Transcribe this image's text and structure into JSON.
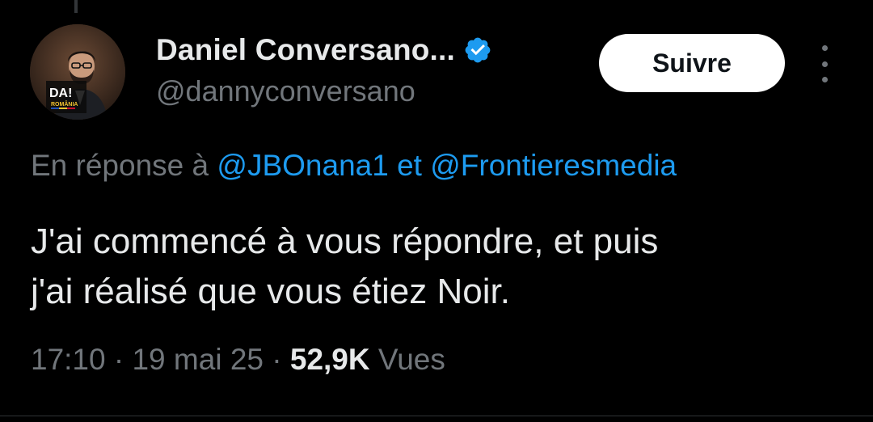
{
  "author": {
    "display_name": "Daniel Conversano...",
    "handle": "@dannyconversano",
    "avatar_text_top": "DA!",
    "avatar_text_bottom": "ROMÂNIA"
  },
  "actions": {
    "follow_label": "Suivre",
    "more_icon": "more-vertical-icon"
  },
  "reply_context": {
    "prefix": "En réponse à",
    "mention_1": "@JBOnana1",
    "connector": "et",
    "mention_2": "@Frontieresmedia"
  },
  "tweet": {
    "line_1": "J'ai commencé à vous répondre, et puis",
    "line_2": "j'ai réalisé que vous étiez Noir."
  },
  "meta": {
    "time": "17:10",
    "separator": "·",
    "date": "19 mai 25",
    "views_count": "52,9K",
    "views_label": "Vues"
  },
  "colors": {
    "background": "#000000",
    "text_primary": "#e7e9ea",
    "text_secondary": "#71767b",
    "accent": "#1d9bf0",
    "follow_button_bg": "#ffffff"
  }
}
